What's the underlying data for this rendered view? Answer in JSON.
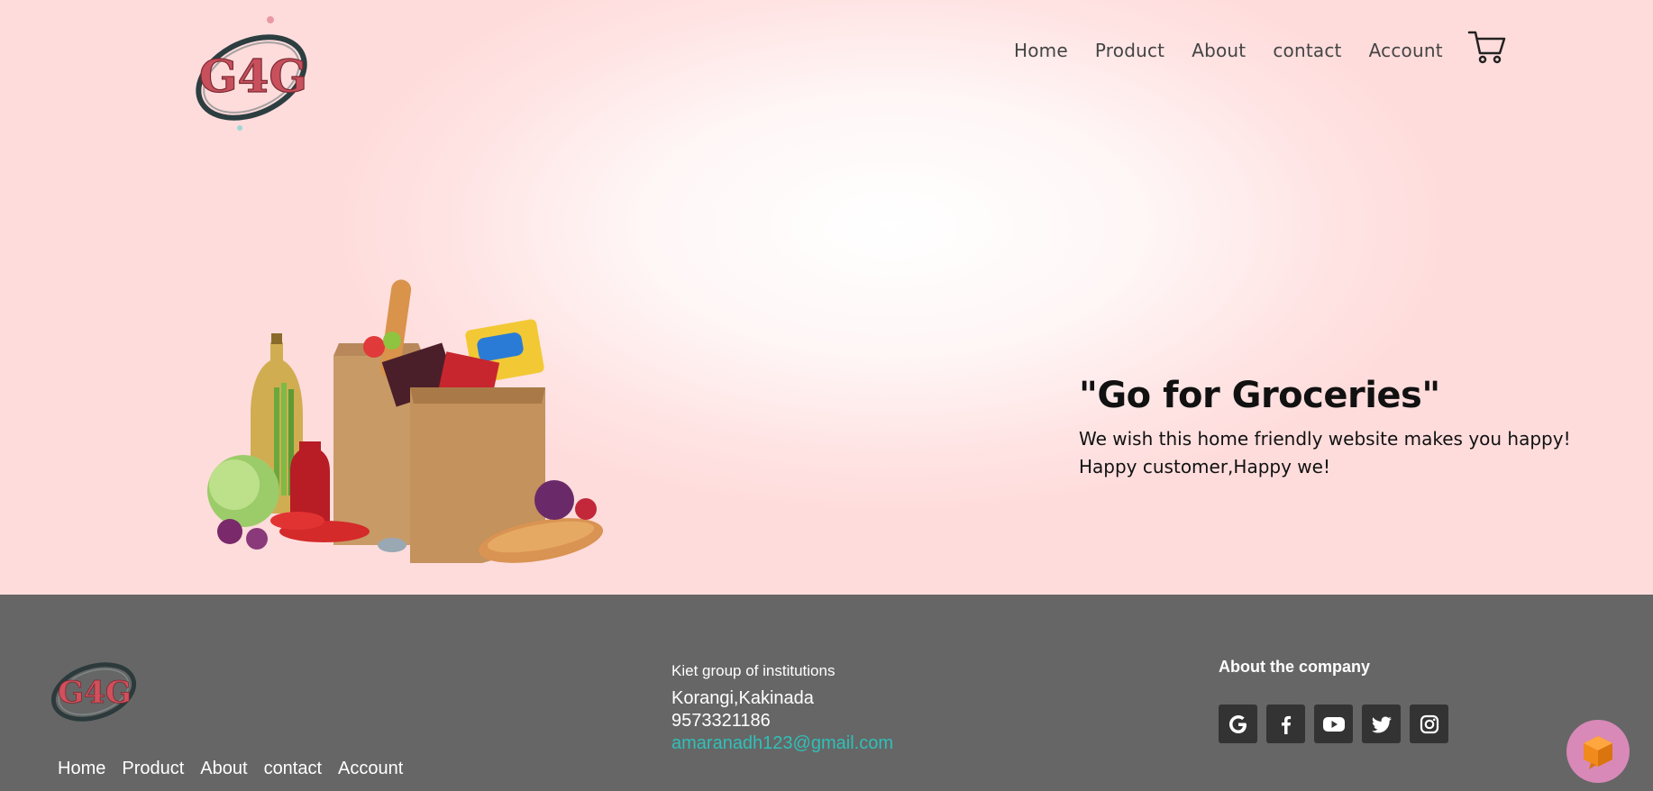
{
  "brand": {
    "logo_text": "G4G"
  },
  "nav": {
    "items": [
      {
        "label": "Home"
      },
      {
        "label": "Product"
      },
      {
        "label": "About"
      },
      {
        "label": "contact"
      },
      {
        "label": "Account"
      }
    ],
    "cart_icon": "shopping-cart-icon"
  },
  "hero": {
    "title": "\"Go for Groceries\"",
    "line1": "We wish this home friendly website makes you happy!",
    "line2": "Happy customer,Happy we!",
    "image": "grocery-bags-image"
  },
  "footer": {
    "logo_text": "G4G",
    "nav": [
      {
        "label": "Home"
      },
      {
        "label": "Product"
      },
      {
        "label": "About"
      },
      {
        "label": "contact"
      },
      {
        "label": "Account"
      }
    ],
    "institution": "Kiet group of institutions",
    "address": "Korangi,Kakinada",
    "phone": "9573321186",
    "email": "amaranadh123@gmail.com",
    "about_heading": "About the company",
    "social_icons": [
      "google-icon",
      "facebook-icon",
      "youtube-icon",
      "twitter-icon",
      "instagram-icon"
    ]
  },
  "colors": {
    "hero_bg": "#ffdcdc",
    "footer_bg": "#666666",
    "email_link": "#2fc0b8",
    "social_bg": "#333333",
    "chat_button": "#d889b8",
    "chat_icon": "#f08a1c"
  },
  "chat_widget": {
    "icon": "chat-cube-icon"
  }
}
